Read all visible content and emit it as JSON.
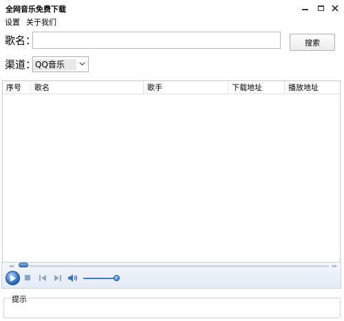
{
  "window": {
    "title": "全网音乐免费下载"
  },
  "menu": [
    {
      "label": "设置"
    },
    {
      "label": "关于我们"
    }
  ],
  "search": {
    "label": "歌名：",
    "value": "",
    "placeholder": "",
    "button_label": "搜索"
  },
  "channel": {
    "label": "渠道：",
    "selected": "QQ音乐"
  },
  "table": {
    "columns": [
      {
        "label": "序号"
      },
      {
        "label": "歌名"
      },
      {
        "label": "歌手"
      },
      {
        "label": "下载地址"
      },
      {
        "label": "播放地址"
      }
    ],
    "rows": []
  },
  "player": {
    "icons": [
      "play-icon",
      "stop-icon",
      "previous-icon",
      "next-icon",
      "volume-icon"
    ],
    "accent_color": "#2b6cc4"
  },
  "hint": {
    "label": "提示"
  }
}
